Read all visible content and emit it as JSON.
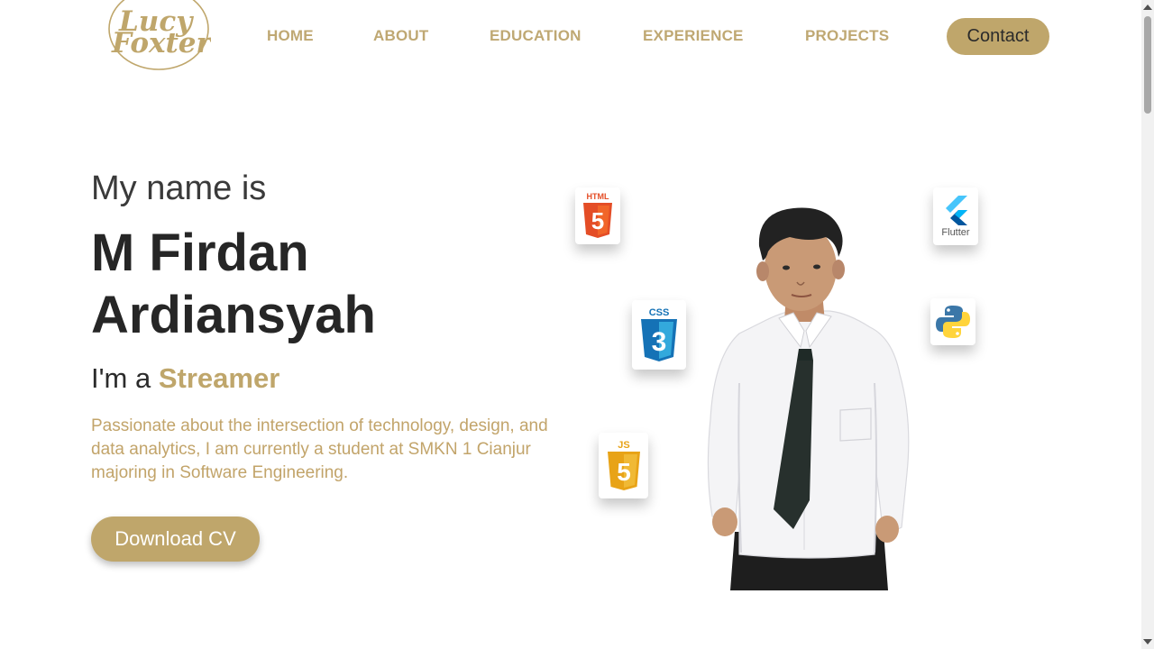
{
  "logo": {
    "line1": "Lucy",
    "line2": "Foxter"
  },
  "nav": {
    "items": [
      "HOME",
      "ABOUT",
      "EDUCATION",
      "EXPERIENCE",
      "PROJECTS"
    ],
    "contact_label": "Contact"
  },
  "hero": {
    "intro": "My name is",
    "name_line1": "M Firdan",
    "name_line2": "Ardiansyah",
    "role_prefix": "I'm a",
    "role_highlight": "Streamer",
    "description": "Passionate about the intersection of technology, design, and data analytics, I am currently a student at SMKN 1 Cianjur majoring in Software Engineering.",
    "cv_button": "Download CV"
  },
  "tech": {
    "html_label": "HTML",
    "html_digit": "5",
    "css_label": "CSS",
    "css_digit": "3",
    "js_label": "JS",
    "js_digit": "5",
    "flutter_label": "Flutter",
    "python_icon": "python-logo"
  },
  "colors": {
    "accent": "#bfa66b",
    "text_dark": "#262626",
    "description": "#c2a46a"
  }
}
